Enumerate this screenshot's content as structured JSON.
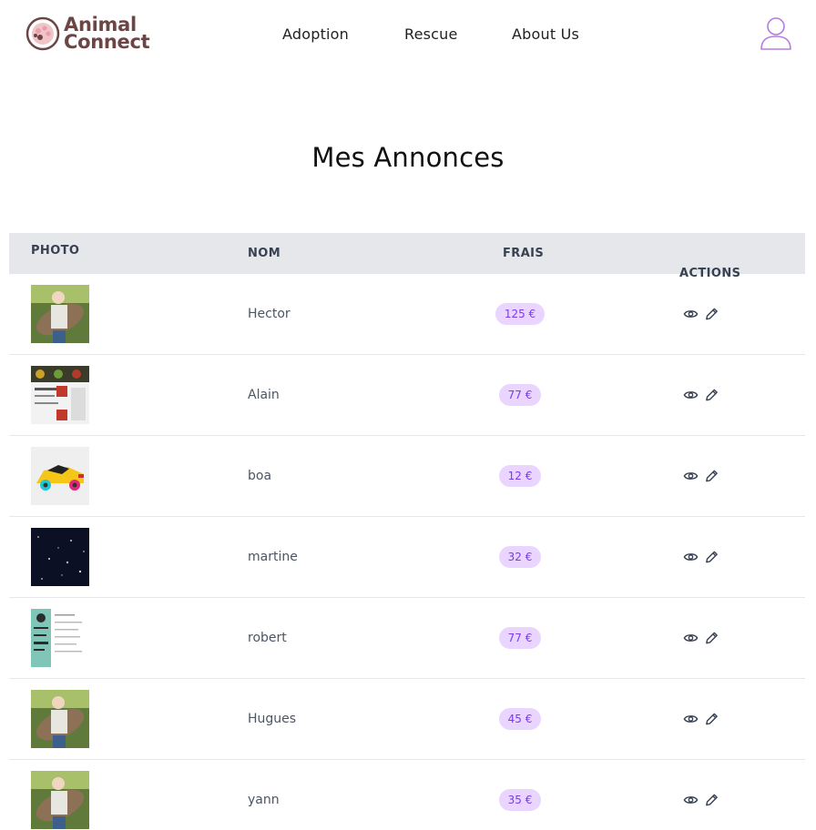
{
  "brand": {
    "line1": "Animal",
    "line2": "Connect",
    "color": "#6b4645",
    "accent": "#e8a0a8"
  },
  "nav": {
    "adoption": "Adoption",
    "rescue": "Rescue",
    "about": "About Us"
  },
  "user_icon_color": "#b57be0",
  "page_title": "Mes Annonces",
  "table": {
    "headers": {
      "photo": "PHOTO",
      "nom": "NOM",
      "frais": "FRAIS",
      "actions": "ACTIONS"
    },
    "rows": [
      {
        "name": "Hector",
        "price": "125 €",
        "photo": "rabbit-photo"
      },
      {
        "name": "Alain",
        "price": "77 €",
        "photo": "document-collage"
      },
      {
        "name": "boa",
        "price": "12 €",
        "photo": "toy-car"
      },
      {
        "name": "martine",
        "price": "32 €",
        "photo": "starfield"
      },
      {
        "name": "robert",
        "price": "77 €",
        "photo": "resume-document"
      },
      {
        "name": "Hugues",
        "price": "45 €",
        "photo": "rabbit-photo"
      },
      {
        "name": "yann",
        "price": "35 €",
        "photo": "rabbit-photo"
      }
    ]
  },
  "colors": {
    "header_bg": "#e5e7eb",
    "badge_bg": "#e9d5ff",
    "badge_text": "#7c3aed"
  }
}
